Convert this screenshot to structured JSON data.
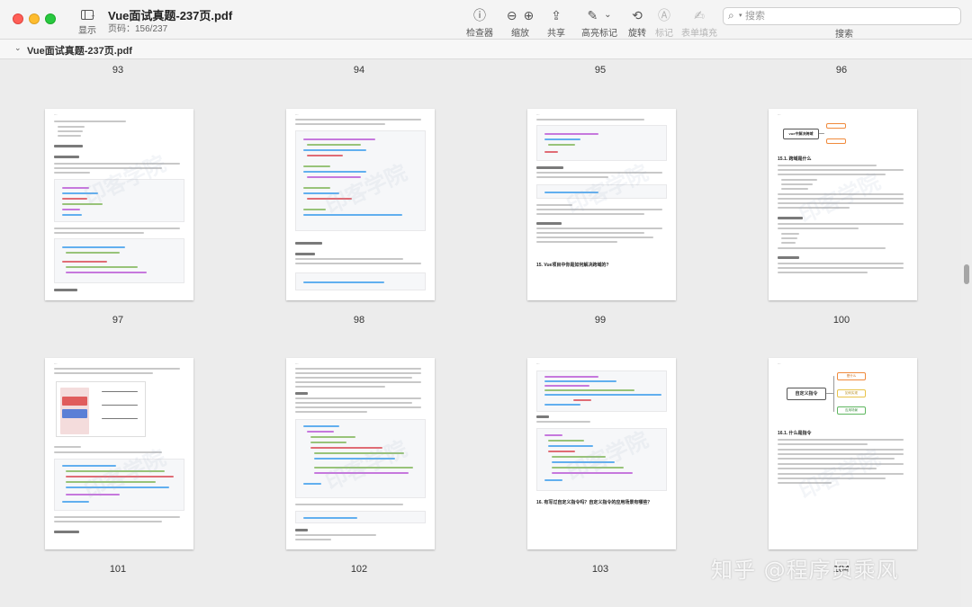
{
  "window": {
    "title": "Vue面试真题-237页.pdf",
    "page_indicator": "页码：156/237"
  },
  "toolbar": {
    "sidebar_label": "显示",
    "inspector_label": "检查器",
    "zoom_label": "缩放",
    "share_label": "共享",
    "highlight_label": "高亮标记",
    "rotate_label": "旋转",
    "markup_label": "标记",
    "form_label": "表单填充",
    "search_label": "搜索",
    "search_placeholder": "搜索"
  },
  "file_header": {
    "name": "Vue面试真题-237页.pdf"
  },
  "page_numbers_top": [
    "93",
    "94",
    "95",
    "96"
  ],
  "pages_row1": [
    {
      "number": "97"
    },
    {
      "number": "98"
    },
    {
      "number": "99",
      "heading": "15. Vue项目中你是如何解决跨域的?"
    },
    {
      "number": "100",
      "diagram_root": "vue中解决跨域",
      "heading": "15.1. 跨域是什么"
    }
  ],
  "pages_row2": [
    {
      "number": "101"
    },
    {
      "number": "102"
    },
    {
      "number": "103",
      "heading": "16. 有写过自定义指令吗？自定义指令的应用场景有哪些？"
    },
    {
      "number": "104",
      "diagram_root": "自定义指令",
      "diagram_nodes": [
        "是什么",
        "如何实现",
        "应用场景"
      ],
      "heading": "16.1. 什么是指令"
    }
  ],
  "watermark": "知乎 @程序员乘风",
  "colors": {
    "traffic_red": "#ff5f57",
    "traffic_yellow": "#febc2e",
    "traffic_green": "#28c840",
    "mindmap_orange": "#f08a3c",
    "mindmap_green": "#5fb760",
    "mindmap_yellow": "#e8c34a"
  }
}
